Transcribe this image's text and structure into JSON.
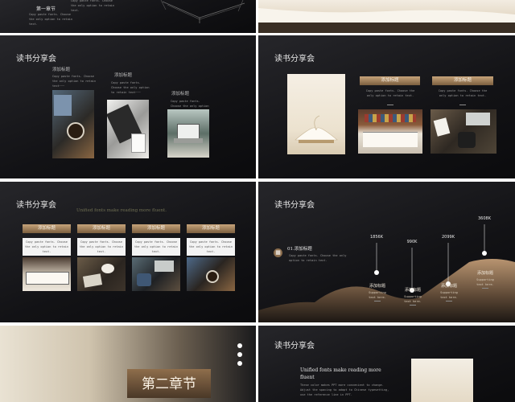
{
  "slide1": {
    "chapter": "第一章节",
    "body": "Copy paste fonts. Choose the only option to retain text.",
    "side_body": "Copy paste fonts. Choose the only option to retain text."
  },
  "slide3": {
    "title": "读书分享会",
    "items": [
      {
        "label": "添加标题",
        "body": "Copy paste fonts. Choose the only option to retain text~~~"
      },
      {
        "label": "添加标题",
        "body": "Copy paste fonts. Choose the only option to retain text~~~"
      },
      {
        "label": "添加标题",
        "body": "Copy paste fonts. Choose the only option to retain"
      }
    ]
  },
  "slide4": {
    "title": "读书分享会",
    "cards": [
      {
        "label": "添加标题",
        "body": "Copy paste fonts. Choose the only option to retain text."
      },
      {
        "label": "添加标题",
        "body": "Copy paste fonts. Choose the only option to retain text."
      }
    ]
  },
  "slide5": {
    "title": "读书分享会",
    "subtitle": "Unified fonts make reading more fluent.",
    "cards": [
      {
        "label": "添加标题",
        "body": "Copy paste fonts. Choose the only option to retain text."
      },
      {
        "label": "添加标题",
        "body": "Copy paste fonts. Choose the only option to retain text."
      },
      {
        "label": "添加标题",
        "body": "Copy paste fonts. Choose the only option to retain text."
      },
      {
        "label": "添加标题",
        "body": "Copy paste fonts. Choose the only option to retain text."
      }
    ]
  },
  "slide6": {
    "title": "读书分享会",
    "intro_label": "01.添加标题",
    "intro_body": "Copy paste fonts. Choose the only option to retain text.",
    "points": [
      {
        "value": "1856K",
        "label": "添加标题",
        "body": "Supporting text here."
      },
      {
        "value": "990K",
        "label": "添加标题",
        "body": "Supporting text here."
      },
      {
        "value": "2099K",
        "label": "添加标题",
        "body": "Supporting text here."
      },
      {
        "value": "3608K",
        "label": "添加标题",
        "body": "Supporting text here."
      }
    ]
  },
  "slide7": {
    "chapter": "第二章节"
  },
  "slide8": {
    "title": "读书分享会",
    "heading": "Unified fonts make reading more fluent",
    "body": "These color makes PPT more convenient to change. Adjust the spacing to adapt to Chinese typesetting, use the reference line in PPT."
  },
  "colors": {
    "accent": "#b08d64",
    "dark": "#141416",
    "gold_light": "#c6a37a"
  }
}
